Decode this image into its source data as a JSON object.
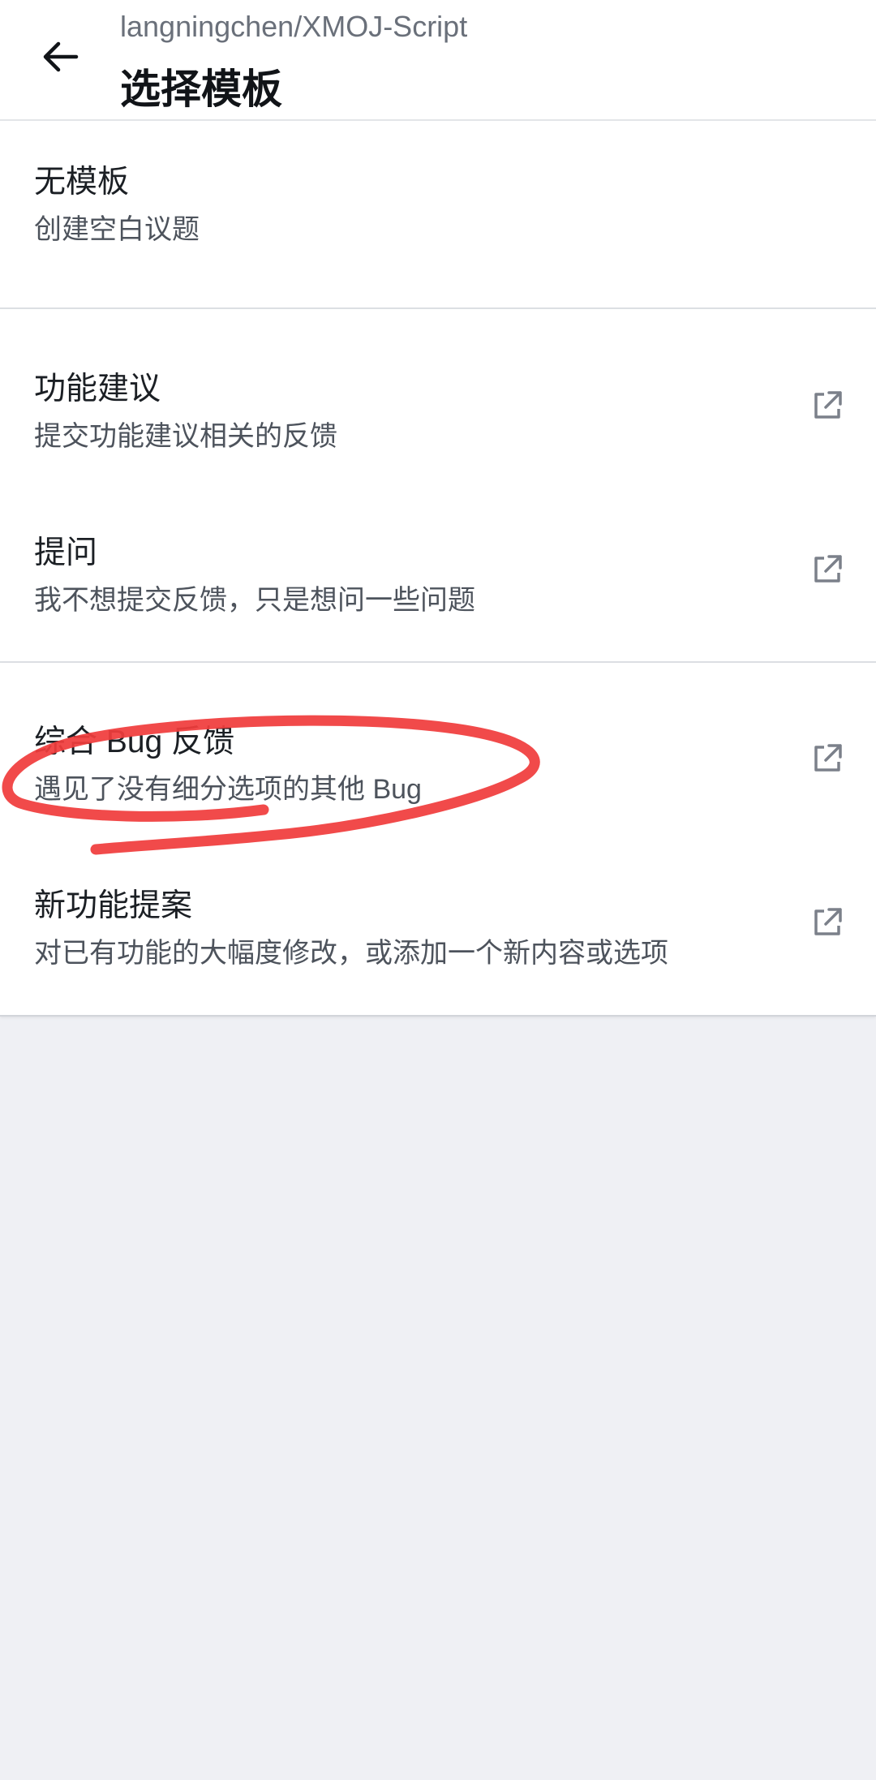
{
  "header": {
    "back_icon": "arrow-left-icon",
    "repo": "langningchen/XMOJ-Script",
    "title": "选择模板"
  },
  "templates": [
    {
      "title": "无模板",
      "description": "创建空白议题",
      "external": false
    },
    {
      "title": "功能建议",
      "description": "提交功能建议相关的反馈",
      "external": true,
      "icon": "external-link-icon"
    },
    {
      "title": "提问",
      "description": "我不想提交反馈，只是想问一些问题",
      "external": true,
      "icon": "external-link-icon"
    },
    {
      "title": "综合 Bug 反馈",
      "description": "遇见了没有细分选项的其他 Bug",
      "external": true,
      "icon": "external-link-icon"
    },
    {
      "title": "新功能提案",
      "description": "对已有功能的大幅度修改，或添加一个新内容或选项",
      "external": true,
      "icon": "external-link-icon"
    }
  ],
  "annotation": {
    "shape": "hand-drawn-ellipse",
    "color": "#f03c3c",
    "target": "综合 Bug 反馈"
  },
  "colors": {
    "background": "#eff0f4",
    "surface": "#ffffff",
    "icon": "#7b808a"
  }
}
